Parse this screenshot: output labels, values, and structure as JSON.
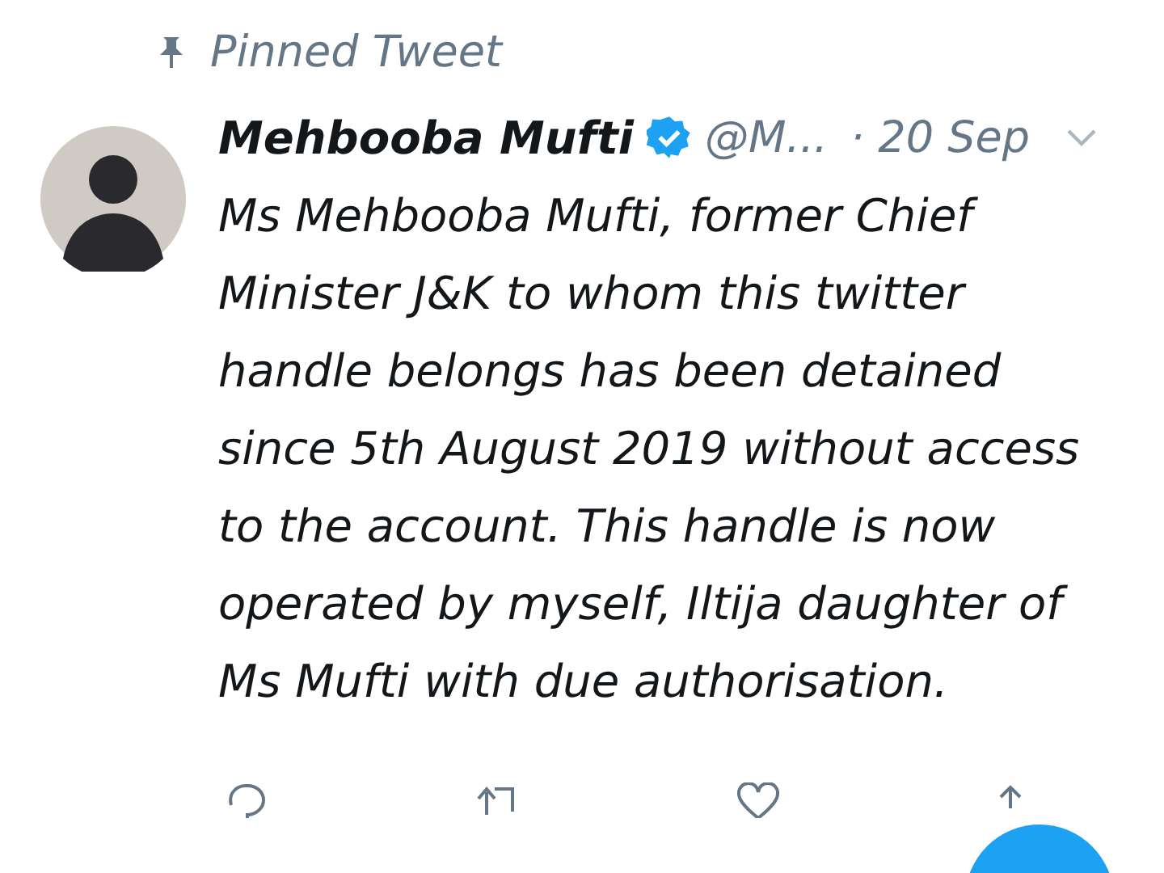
{
  "pinned_label": "Pinned Tweet",
  "tweet": {
    "author_name": "Mehbooba Mufti",
    "verified": true,
    "handle": "@M...",
    "time": "· 20 Sep",
    "text": "Ms Mehbooba Mufti, former Chief Minister J&K to whom this twitter handle belongs has been detained since 5th August 2019 without access to the account. This handle is now operated by myself, Iltija daughter of Ms Mufti with due authorisation."
  }
}
